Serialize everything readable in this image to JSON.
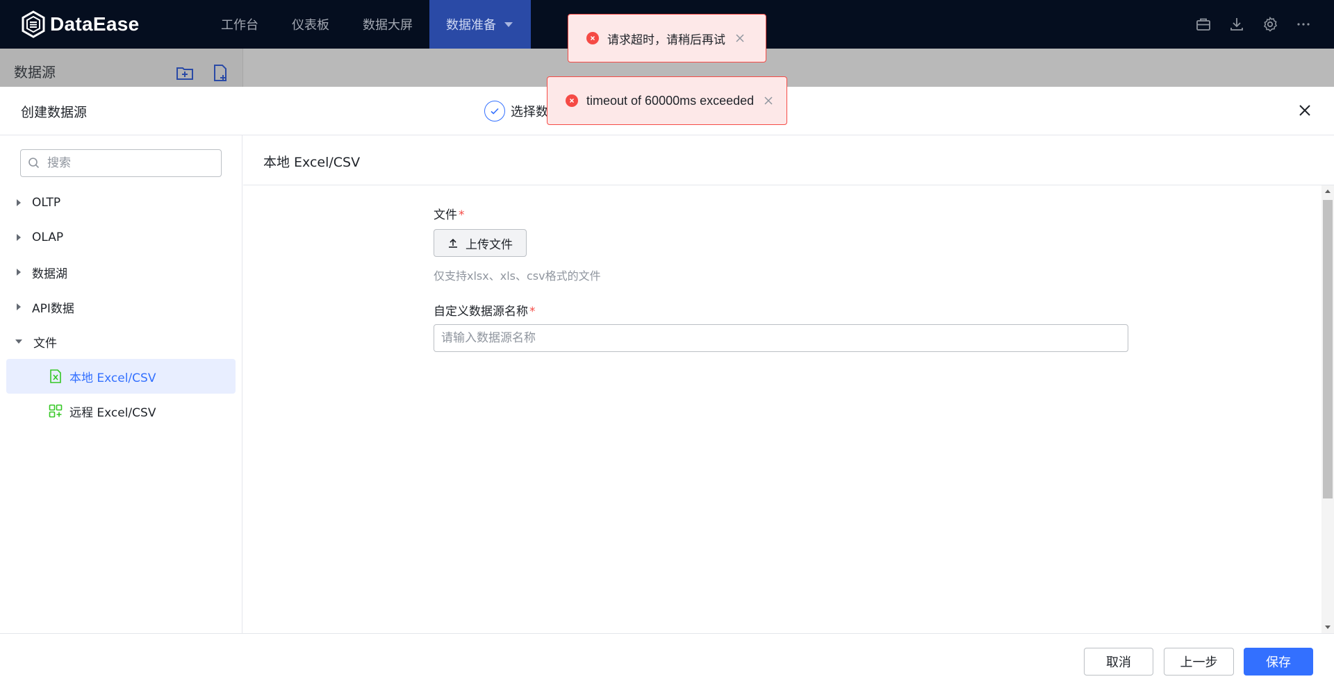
{
  "app": {
    "name": "DataEase"
  },
  "nav": {
    "items": [
      {
        "label": "工作台"
      },
      {
        "label": "仪表板"
      },
      {
        "label": "数据大屏"
      },
      {
        "label": "数据准备"
      }
    ]
  },
  "background_page": {
    "title": "数据源"
  },
  "drawer": {
    "title": "创建数据源",
    "step_label": "选择数"
  },
  "left_panel": {
    "search_placeholder": "搜索",
    "tree": {
      "oltp": "OLTP",
      "olap": "OLAP",
      "lake": "数据湖",
      "api": "API数据",
      "file": "文件",
      "local_excel": "本地 Excel/CSV",
      "remote_excel": "远程 Excel/CSV"
    }
  },
  "right_panel": {
    "title": "本地 Excel/CSV",
    "file_label": "文件",
    "required_mark": "*",
    "upload_label": "上传文件",
    "hint": "仅支持xlsx、xls、csv格式的文件",
    "name_label": "自定义数据源名称",
    "name_placeholder": "请输入数据源名称",
    "name_value": ""
  },
  "footer": {
    "cancel": "取消",
    "prev": "上一步",
    "save": "保存"
  },
  "toasts": [
    {
      "message": "请求超时，请稍后再试"
    },
    {
      "message": "timeout of 60000ms exceeded"
    }
  ],
  "colors": {
    "primary": "#3370ff",
    "error": "#f54a45",
    "topbar": "#050e1f",
    "nav_active": "#2a4aa6",
    "excel_green": "#34c724"
  }
}
